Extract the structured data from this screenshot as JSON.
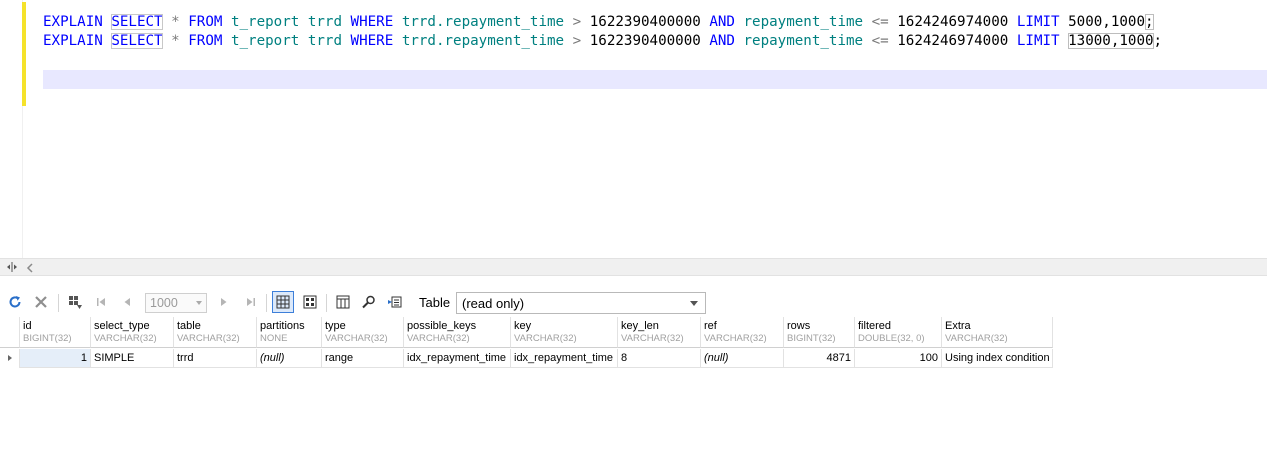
{
  "editor": {
    "lines": [
      [
        {
          "t": "EXPLAIN ",
          "c": "kw"
        },
        {
          "t": "SELECT",
          "c": "sel"
        },
        {
          "t": " ",
          "c": ""
        },
        {
          "t": "*",
          "c": "op"
        },
        {
          "t": " ",
          "c": ""
        },
        {
          "t": "FROM",
          "c": "kw"
        },
        {
          "t": " ",
          "c": ""
        },
        {
          "t": "t_report trrd",
          "c": "id"
        },
        {
          "t": " ",
          "c": ""
        },
        {
          "t": "WHERE",
          "c": "kw"
        },
        {
          "t": " ",
          "c": ""
        },
        {
          "t": "trrd.repayment_time",
          "c": "id"
        },
        {
          "t": " > ",
          "c": "op"
        },
        {
          "t": "1622390400000",
          "c": "num"
        },
        {
          "t": " ",
          "c": ""
        },
        {
          "t": "AND",
          "c": "kw"
        },
        {
          "t": " ",
          "c": ""
        },
        {
          "t": "repayment_time",
          "c": "id"
        },
        {
          "t": " <= ",
          "c": "op"
        },
        {
          "t": "1624246974000",
          "c": "num"
        },
        {
          "t": " ",
          "c": ""
        },
        {
          "t": "LIMIT",
          "c": "kw"
        },
        {
          "t": " ",
          "c": ""
        },
        {
          "t": "5000,1000",
          "c": "num"
        },
        {
          "t": ";",
          "c": "bracket"
        }
      ],
      [
        {
          "t": "EXPLAIN ",
          "c": "kw"
        },
        {
          "t": "SELECT",
          "c": "sel"
        },
        {
          "t": " ",
          "c": ""
        },
        {
          "t": "*",
          "c": "op"
        },
        {
          "t": " ",
          "c": ""
        },
        {
          "t": "FROM",
          "c": "kw"
        },
        {
          "t": " ",
          "c": ""
        },
        {
          "t": "t_report trrd",
          "c": "id"
        },
        {
          "t": " ",
          "c": ""
        },
        {
          "t": "WHERE",
          "c": "kw"
        },
        {
          "t": " ",
          "c": ""
        },
        {
          "t": "trrd.repayment_time",
          "c": "id"
        },
        {
          "t": " > ",
          "c": "op"
        },
        {
          "t": "1622390400000",
          "c": "num"
        },
        {
          "t": " ",
          "c": ""
        },
        {
          "t": "AND",
          "c": "kw"
        },
        {
          "t": " ",
          "c": ""
        },
        {
          "t": "repayment_time",
          "c": "id"
        },
        {
          "t": " <= ",
          "c": "op"
        },
        {
          "t": "1624246974000",
          "c": "num"
        },
        {
          "t": " ",
          "c": ""
        },
        {
          "t": "LIMIT",
          "c": "kw"
        },
        {
          "t": " ",
          "c": ""
        },
        {
          "t": "13000,1000",
          "c": "bracket"
        },
        {
          "t": ";",
          "c": "num"
        }
      ]
    ]
  },
  "toolbar": {
    "limit_value": "1000",
    "view_label": "Table",
    "view_value": "(read only)",
    "icons": [
      "refresh-icon",
      "cancel-icon",
      "row-filter-icon",
      "first-page-icon",
      "prev-page-icon",
      "next-page-icon",
      "last-page-icon",
      "grid-view-icon",
      "form-view-icon",
      "column-settings-icon",
      "search-icon",
      "export-icon"
    ]
  },
  "grid": {
    "columns": [
      {
        "name": "id",
        "type": "BIGINT(32)"
      },
      {
        "name": "select_type",
        "type": "VARCHAR(32)"
      },
      {
        "name": "table",
        "type": "VARCHAR(32)"
      },
      {
        "name": "partitions",
        "type": "NONE"
      },
      {
        "name": "type",
        "type": "VARCHAR(32)"
      },
      {
        "name": "possible_keys",
        "type": "VARCHAR(32)"
      },
      {
        "name": "key",
        "type": "VARCHAR(32)"
      },
      {
        "name": "key_len",
        "type": "VARCHAR(32)"
      },
      {
        "name": "ref",
        "type": "VARCHAR(32)"
      },
      {
        "name": "rows",
        "type": "BIGINT(32)"
      },
      {
        "name": "filtered",
        "type": "DOUBLE(32, 0)"
      },
      {
        "name": "Extra",
        "type": "VARCHAR(32)"
      }
    ],
    "rows": [
      [
        "1",
        "SIMPLE",
        "trrd",
        "(null)",
        "range",
        "idx_repayment_time",
        "idx_repayment_time",
        "8",
        "(null)",
        "4871",
        "100",
        "Using index condition"
      ]
    ]
  },
  "colors": {
    "keyword": "#0000ff",
    "identifier": "#008080",
    "operator": "#7a7a7a",
    "current_line": "#e8e8ff",
    "gutter_marker": "#f5e22a",
    "active_cell": "#e5eef9"
  }
}
